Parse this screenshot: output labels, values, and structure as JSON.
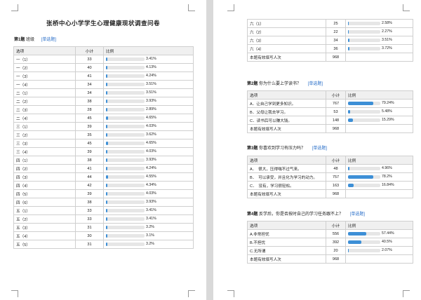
{
  "left": {
    "title": "张桥中心小学学生心理健康现状调查问卷",
    "q1": {
      "num": "第1题",
      "text": "班级",
      "type": "[单选题]",
      "headers": [
        "选项",
        "小计",
        "比例"
      ],
      "rows": [
        {
          "label": "一（1）",
          "count": "33",
          "pct": "3.41%",
          "value": 3.41
        },
        {
          "label": "一（2）",
          "count": "40",
          "pct": "4.13%",
          "value": 4.13
        },
        {
          "label": "一（3）",
          "count": "41",
          "pct": "4.24%",
          "value": 4.24
        },
        {
          "label": "一（4）",
          "count": "34",
          "pct": "3.51%",
          "value": 3.51
        },
        {
          "label": "二（1）",
          "count": "34",
          "pct": "3.51%",
          "value": 3.51
        },
        {
          "label": "二（2）",
          "count": "38",
          "pct": "3.93%",
          "value": 3.93
        },
        {
          "label": "二（3）",
          "count": "28",
          "pct": "2.89%",
          "value": 2.89
        },
        {
          "label": "二（4）",
          "count": "45",
          "pct": "4.65%",
          "value": 4.65
        },
        {
          "label": "三（1）",
          "count": "39",
          "pct": "4.03%",
          "value": 4.03
        },
        {
          "label": "三（2）",
          "count": "35",
          "pct": "3.62%",
          "value": 3.62
        },
        {
          "label": "三（3）",
          "count": "45",
          "pct": "4.65%",
          "value": 4.65
        },
        {
          "label": "三（4）",
          "count": "39",
          "pct": "4.03%",
          "value": 4.03
        },
        {
          "label": "四（1）",
          "count": "38",
          "pct": "3.93%",
          "value": 3.93
        },
        {
          "label": "四（2）",
          "count": "41",
          "pct": "4.24%",
          "value": 4.24
        },
        {
          "label": "四（3）",
          "count": "44",
          "pct": "4.55%",
          "value": 4.55
        },
        {
          "label": "四（4）",
          "count": "42",
          "pct": "4.34%",
          "value": 4.34
        },
        {
          "label": "四（5）",
          "count": "39",
          "pct": "4.03%",
          "value": 4.03
        },
        {
          "label": "四（6）",
          "count": "38",
          "pct": "3.93%",
          "value": 3.93
        },
        {
          "label": "五（1）",
          "count": "33",
          "pct": "3.41%",
          "value": 3.41
        },
        {
          "label": "五（2）",
          "count": "33",
          "pct": "3.41%",
          "value": 3.41
        },
        {
          "label": "五（3）",
          "count": "31",
          "pct": "3.2%",
          "value": 3.2
        },
        {
          "label": "五（4）",
          "count": "30",
          "pct": "3.1%",
          "value": 3.1
        },
        {
          "label": "五（5）",
          "count": "31",
          "pct": "3.2%",
          "value": 3.2
        }
      ]
    }
  },
  "right": {
    "q1_cont": {
      "rows": [
        {
          "label": "六（1）",
          "count": "25",
          "pct": "2.58%",
          "value": 2.58
        },
        {
          "label": "六（2）",
          "count": "22",
          "pct": "2.27%",
          "value": 2.27
        },
        {
          "label": "六（3）",
          "count": "34",
          "pct": "3.51%",
          "value": 3.51
        },
        {
          "label": "六（4）",
          "count": "36",
          "pct": "3.72%",
          "value": 3.72
        }
      ],
      "total_label": "本题有效填写人次",
      "total": "968"
    },
    "q2": {
      "num": "第2题",
      "text": "你为什么要上学读书？",
      "type": "[单选题]",
      "headers": [
        "选项",
        "小计",
        "比例"
      ],
      "rows": [
        {
          "label": "A．让自己学到更多知识。",
          "count": "767",
          "pct": "79.24%",
          "value": 79.24
        },
        {
          "label": "B．父母让我去学习。",
          "count": "53",
          "pct": "5.48%",
          "value": 5.48
        },
        {
          "label": "C．读书后可以赚大钱。",
          "count": "148",
          "pct": "15.29%",
          "value": 15.29
        }
      ],
      "total_label": "本题有效填写人次",
      "total": "968"
    },
    "q3": {
      "num": "第3题",
      "text": "你喜欢到学习有压力吗？",
      "type": "[单选题]",
      "headers": [
        "选项",
        "小计",
        "比例"
      ],
      "rows": [
        {
          "label": "A．　很大，压得喘不过气来。",
          "count": "48",
          "pct": "4.96%",
          "value": 4.96
        },
        {
          "label": "B．　可以承受，并且化为学习的动力。",
          "count": "757",
          "pct": "78.2%",
          "value": 78.2
        },
        {
          "label": "C．　没有，学习很轻松。",
          "count": "163",
          "pct": "16.84%",
          "value": 16.84
        }
      ],
      "total_label": "本题有效填写人次",
      "total": "968"
    },
    "q4": {
      "num": "第4题",
      "text": "反学后，你是否按时自己的学习任务跟不上？",
      "type": "[单选题]",
      "headers": [
        "选项",
        "小计",
        "比例"
      ],
      "rows": [
        {
          "label": "A.非常担忧",
          "count": "556",
          "pct": "57.44%",
          "value": 57.44
        },
        {
          "label": "B.不担忧",
          "count": "392",
          "pct": "40.5%",
          "value": 40.5
        },
        {
          "label": "C.无所谓",
          "count": "20",
          "pct": "2.07%",
          "value": 2.07
        }
      ],
      "total_label": "本题有效填写人次",
      "total": "968"
    }
  }
}
